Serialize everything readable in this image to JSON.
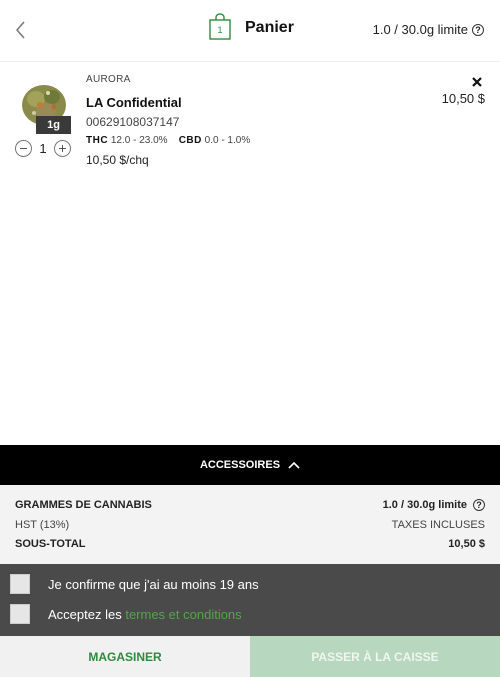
{
  "header": {
    "title": "Panier",
    "bag_count": "1",
    "limit": "1.0 / 30.0g limite",
    "help_glyph": "?",
    "icons": {
      "back": "chevron-left-icon",
      "bag": "shopping-bag-icon",
      "help": "help-circle-icon"
    }
  },
  "cart_item": {
    "brand": "AURORA",
    "name": "LA Confidential",
    "sku": "00629108037147",
    "size_badge": "1g",
    "thc_label": "THC",
    "thc_value": "12.0 - 23.0%",
    "cbd_label": "CBD",
    "cbd_value": "0.0 - 1.0%",
    "unit_price": "10,50 $/chq",
    "quantity": "1",
    "line_price": "10,50 $",
    "icons": {
      "remove": "close-icon",
      "minus": "minus-circle-icon",
      "plus": "plus-circle-icon"
    }
  },
  "accessories": {
    "label": "ACCESSOIRES",
    "icon": "chevron-up-icon"
  },
  "summary": {
    "grams_label": "GRAMMES DE CANNABIS",
    "grams_value": "1.0 / 30.0g limite",
    "tax_label": "HST (13%)",
    "tax_value": "TAXES INCLUSES",
    "subtotal_label": "SOUS-TOTAL",
    "subtotal_value": "10,50 $"
  },
  "confirmations": {
    "age_label": "Je confirme que j'ai au moins 19 ans",
    "terms_prefix": "Acceptez les",
    "terms_link": "termes et conditions"
  },
  "footer": {
    "shop_label": "MAGASINER",
    "checkout_label": "PASSER À LA CAISSE"
  },
  "colors": {
    "accent_green": "#2e8b3c",
    "link_green": "#52a649",
    "checkout_disabled": "#b7d7be",
    "dark_bar": "#000000",
    "confirm_bg": "#4a4a4a"
  }
}
